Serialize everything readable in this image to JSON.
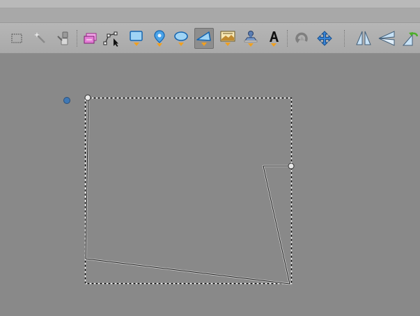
{
  "window": {
    "background": "#898989"
  },
  "toolbar": {
    "tools": [
      {
        "name": "rectangle-select-tool",
        "icon": "dashed-rectangle-icon",
        "active": false
      },
      {
        "name": "magic-wand-tool",
        "icon": "magic-wand-icon",
        "active": false
      },
      {
        "name": "picker-tool",
        "icon": "picker-icon",
        "active": false
      },
      {
        "name": "layer-tool",
        "icon": "layer-icon",
        "active": false
      },
      {
        "name": "edit-path-tool",
        "icon": "edit-path-icon",
        "active": false
      },
      {
        "name": "draw-rectangle-tool",
        "icon": "rectangle-shape-icon",
        "active": false
      },
      {
        "name": "draw-pin-tool",
        "icon": "map-pin-icon",
        "active": false
      },
      {
        "name": "draw-ellipse-tool",
        "icon": "ellipse-shape-icon",
        "active": false
      },
      {
        "name": "draw-polygon-tool",
        "icon": "polygon-shape-icon",
        "active": true
      },
      {
        "name": "image-tool",
        "icon": "image-icon",
        "active": false
      },
      {
        "name": "stamp-tool",
        "icon": "stamp-icon",
        "active": false
      },
      {
        "name": "text-tool",
        "icon": "text-icon",
        "active": false
      },
      {
        "name": "rotate-tool",
        "icon": "rotate-icon",
        "active": false
      },
      {
        "name": "move-tool",
        "icon": "move-arrows-icon",
        "active": false
      },
      {
        "name": "perspective-tool",
        "icon": "perspective-icon",
        "active": false
      },
      {
        "name": "skew-tool",
        "icon": "skew-icon",
        "active": false
      },
      {
        "name": "flip-tool",
        "icon": "flip-icon",
        "active": false
      }
    ]
  },
  "colors": {
    "accent": "#2e7fd0",
    "dropdown_arrow": "#f0a020",
    "selection_outline": "#000000",
    "shape_stroke": "#1e1e1e"
  }
}
